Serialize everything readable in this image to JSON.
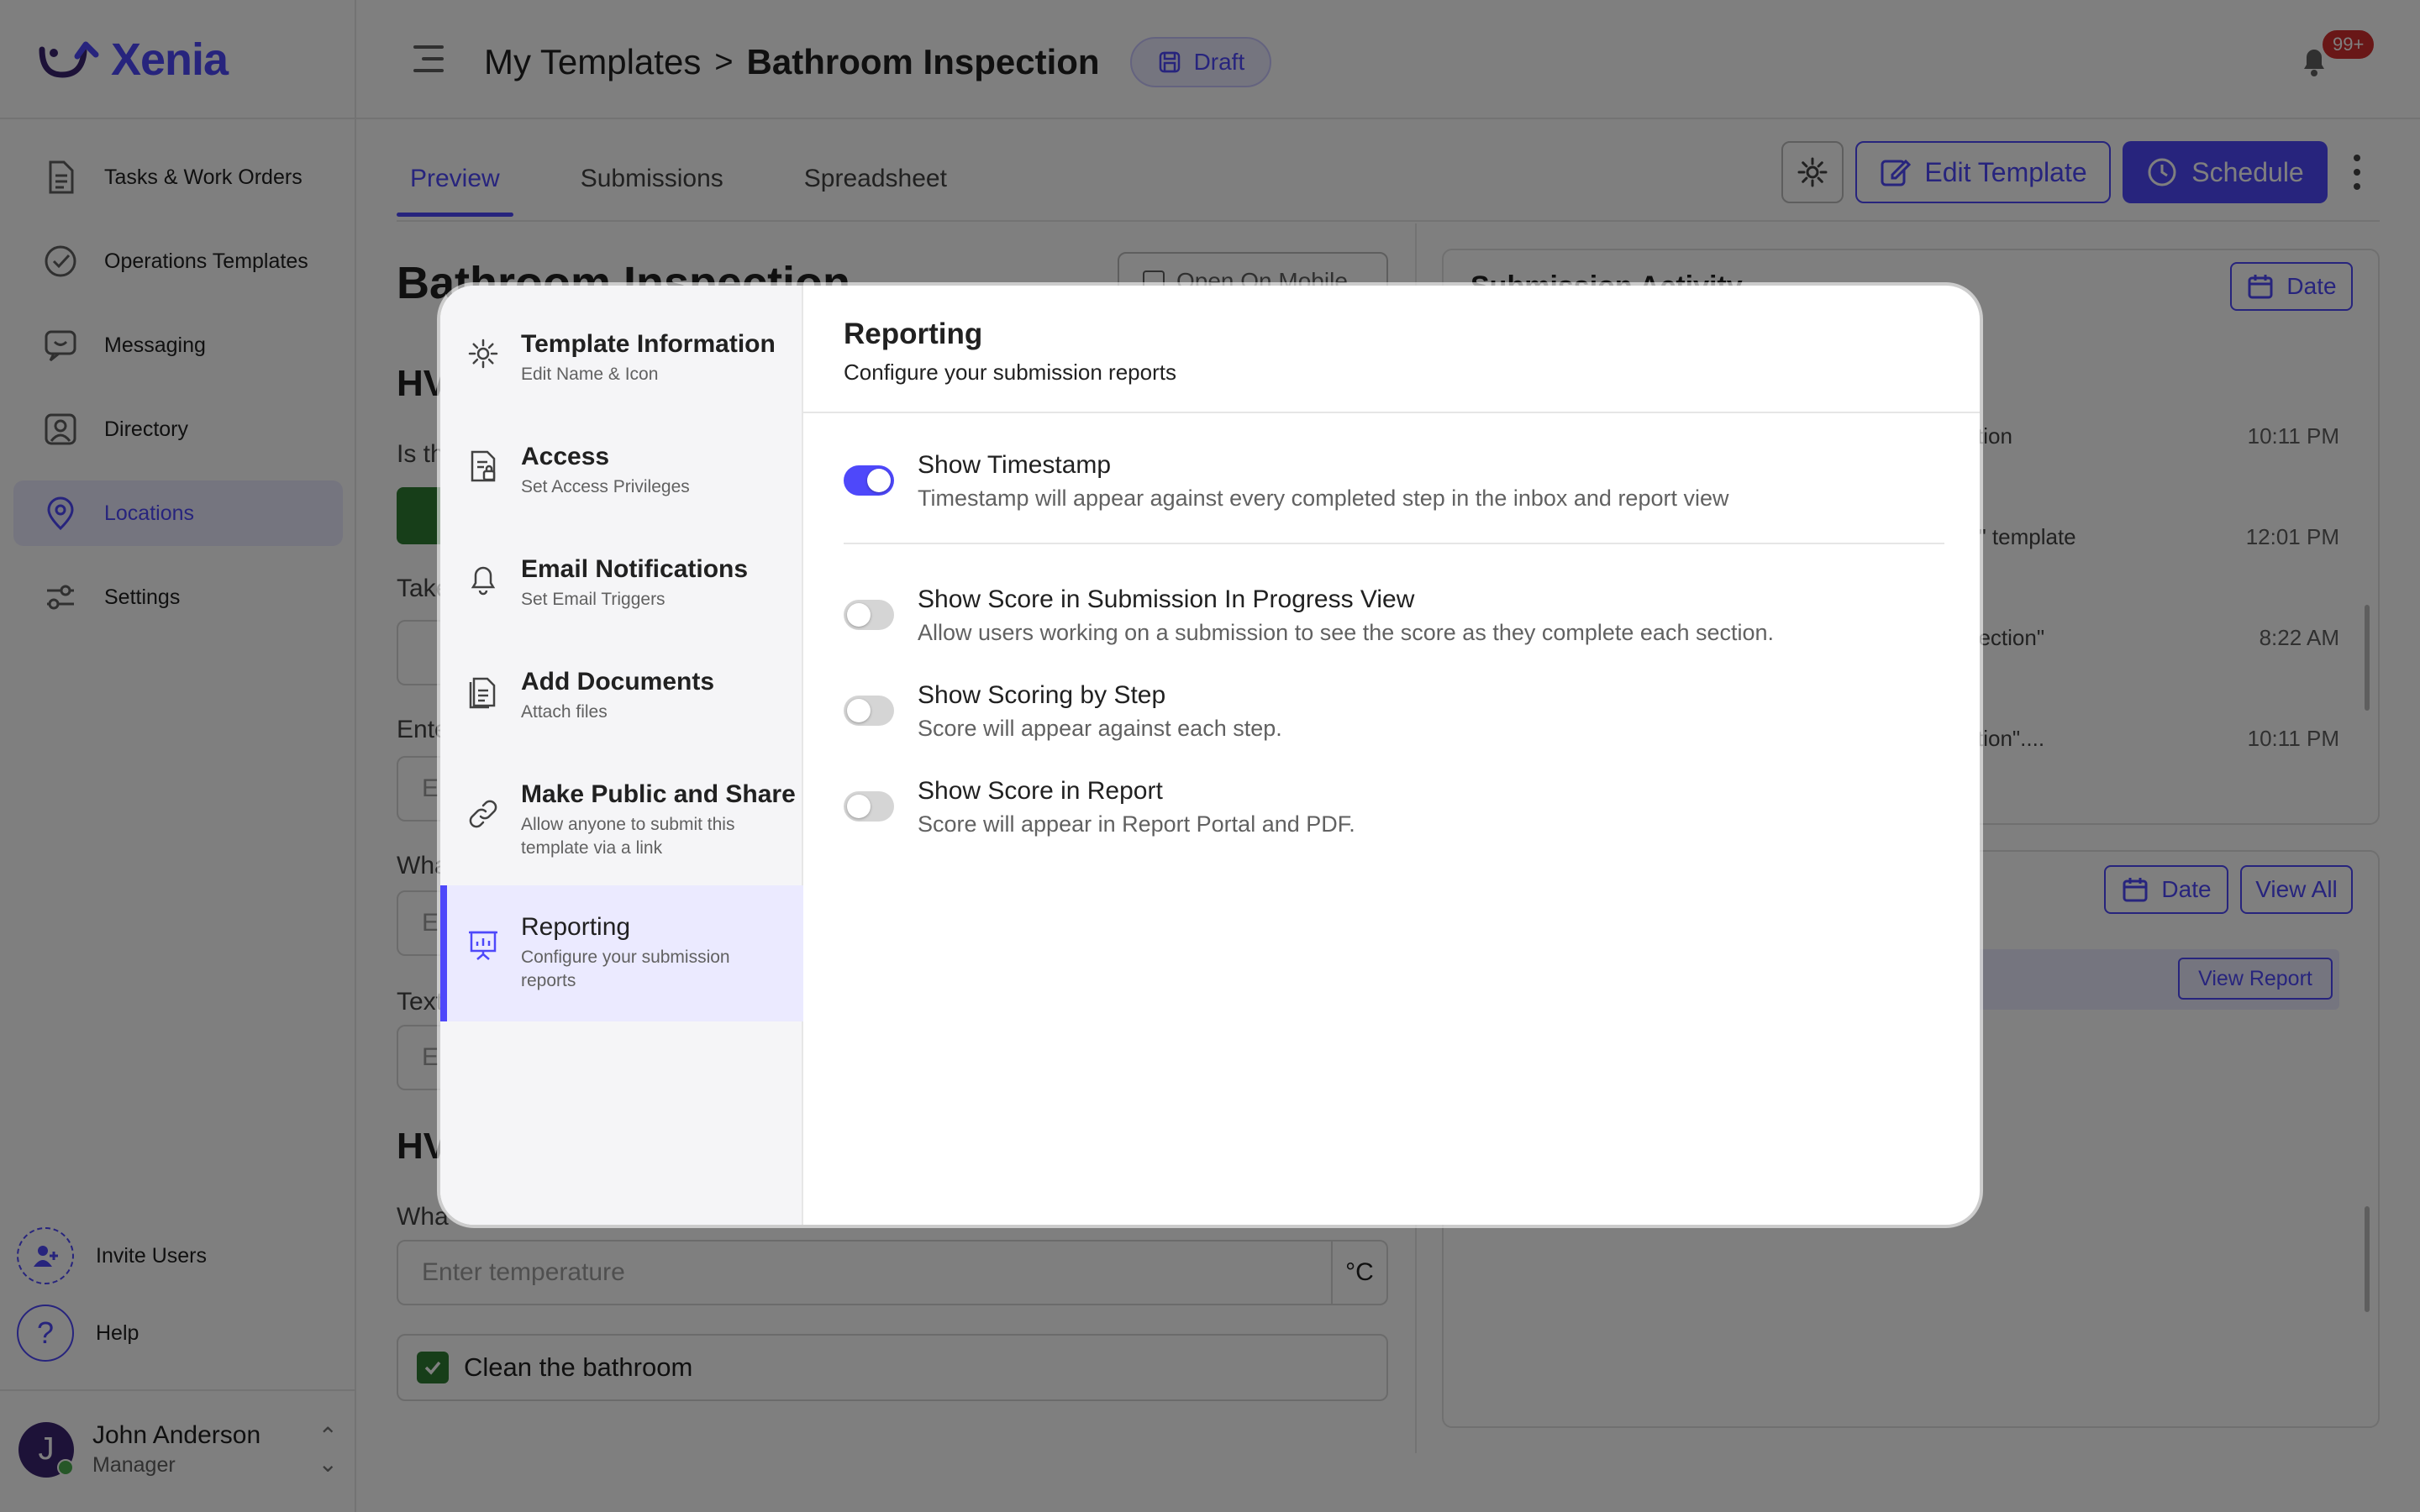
{
  "app": {
    "logo_text": "Xenia",
    "brand_color": "#4e48fa"
  },
  "sidebar": {
    "items": [
      {
        "label": "Tasks & Work Orders",
        "icon": "document-icon",
        "active": false
      },
      {
        "label": "Operations Templates",
        "icon": "check-circle-icon",
        "active": false
      },
      {
        "label": "Messaging",
        "icon": "chat-icon",
        "active": false
      },
      {
        "label": "Directory",
        "icon": "contact-icon",
        "active": false
      },
      {
        "label": "Locations",
        "icon": "location-pin-icon",
        "active": true
      },
      {
        "label": "Settings",
        "icon": "sliders-icon",
        "active": false
      }
    ],
    "invite_label": "Invite Users",
    "help_label": "Help",
    "user": {
      "initial": "J",
      "name": "John Anderson",
      "role": "Manager"
    }
  },
  "header": {
    "breadcrumb_parent": "My Templates",
    "breadcrumb_sep": ">",
    "breadcrumb_current": "Bathroom Inspection",
    "status_badge": "Draft",
    "notification_count": "99+"
  },
  "tabs": [
    {
      "label": "Preview",
      "active": true
    },
    {
      "label": "Submissions",
      "active": false
    },
    {
      "label": "Spreadsheet",
      "active": false
    }
  ],
  "actions": {
    "edit_label": "Edit Template",
    "schedule_label": "Schedule"
  },
  "background": {
    "title": "Bathroom Inspection",
    "open_mobile_label": "Open On Mobile",
    "fragments": {
      "hv1": "HV",
      "is_th": "Is th",
      "take": "Take",
      "ente": "Ente",
      "what": "Wha",
      "text": "Text",
      "hv2": "HV",
      "what2": "Wha"
    },
    "input_frags": {
      "e1": "E",
      "e2": "E",
      "e3": "E"
    },
    "temperature_placeholder": "Enter temperature",
    "temperature_unit": "°C",
    "checklist_item": "Clean the bathroom",
    "activity_card_title": "Submission Activity",
    "date_label": "Date",
    "view_all_label": "View All",
    "view_report_label": "View Report",
    "activity": [
      {
        "text": "ction",
        "time": "10:11 PM"
      },
      {
        "text": "n\" template",
        "time": "12:01 PM"
      },
      {
        "text": "pection\"",
        "time": "8:22 AM"
      },
      {
        "text": "ction\"....",
        "time": "10:11 PM"
      }
    ]
  },
  "modal": {
    "menu": [
      {
        "title": "Template Information",
        "sub": "Edit Name & Icon",
        "icon": "gear-icon",
        "active": false
      },
      {
        "title": "Access",
        "sub": "Set Access Privileges",
        "icon": "access-document-icon",
        "active": false
      },
      {
        "title": "Email Notifications",
        "sub": "Set Email Triggers",
        "icon": "bell-icon",
        "active": false
      },
      {
        "title": "Add Documents",
        "sub": "Attach files",
        "icon": "documents-icon",
        "active": false
      },
      {
        "title": "Make Public and Share",
        "sub": "Allow anyone to submit this template via a link",
        "icon": "link-icon",
        "active": false
      },
      {
        "title": "Reporting",
        "sub": "Configure your submission reports",
        "icon": "presentation-chart-icon",
        "active": true
      }
    ],
    "panel_title": "Reporting",
    "panel_subtitle": "Configure your submission reports",
    "options": [
      {
        "title": "Show Timestamp",
        "desc": "Timestamp will appear against every completed step in the inbox and report view",
        "enabled": true
      },
      {
        "title": "Show Score in Submission In Progress View",
        "desc": "Allow users working on a submission to see the score as they complete each section.",
        "enabled": false
      },
      {
        "title": "Show Scoring by Step",
        "desc": "Score will appear against each step.",
        "enabled": false
      },
      {
        "title": "Show Score in Report",
        "desc": "Score will appear in Report Portal and PDF.",
        "enabled": false
      }
    ]
  }
}
